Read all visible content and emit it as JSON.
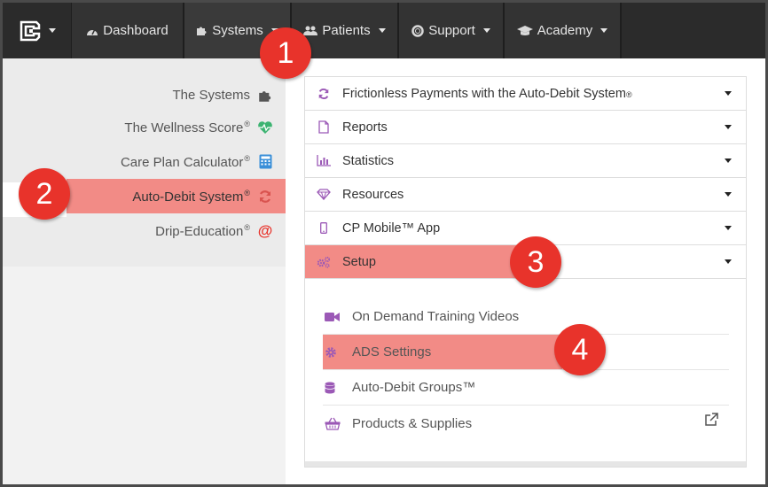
{
  "navbar": {
    "items": [
      {
        "label": "Dashboard",
        "icon": "dashboard-icon"
      },
      {
        "label": "Systems",
        "icon": "puzzle-icon"
      },
      {
        "label": "Patients",
        "icon": "users-icon"
      },
      {
        "label": "Support",
        "icon": "lifebuoy-icon"
      },
      {
        "label": "Academy",
        "icon": "graduation-cap-icon"
      }
    ]
  },
  "sidebar": {
    "items": [
      {
        "label": "The Systems",
        "reg": "",
        "icon": "puzzle-icon"
      },
      {
        "label": "The Wellness Score",
        "reg": "®",
        "icon": "heartbeat-icon"
      },
      {
        "label": "Care Plan Calculator",
        "reg": "®",
        "icon": "calculator-icon"
      },
      {
        "label": "Auto-Debit System",
        "reg": "®",
        "icon": "refresh-icon"
      },
      {
        "label": "Drip-Education",
        "reg": "®",
        "icon": "at-icon"
      }
    ]
  },
  "accordion": {
    "rows": [
      {
        "label": "Frictionless Payments with the Auto-Debit System",
        "reg": "®",
        "icon": "refresh-icon"
      },
      {
        "label": "Reports",
        "reg": "",
        "icon": "file-icon"
      },
      {
        "label": "Statistics",
        "reg": "",
        "icon": "bar-chart-icon"
      },
      {
        "label": "Resources",
        "reg": "",
        "icon": "diamond-icon"
      },
      {
        "label": "CP Mobile™ App",
        "reg": "",
        "icon": "mobile-icon"
      },
      {
        "label": "Setup",
        "reg": "",
        "icon": "cogs-icon"
      }
    ],
    "setup_items": [
      {
        "label": "On Demand Training Videos",
        "icon": "video-camera-icon"
      },
      {
        "label": "ADS Settings",
        "icon": "gear-icon"
      },
      {
        "label": "Auto-Debit Groups™",
        "icon": "database-icon"
      },
      {
        "label": "Products & Supplies",
        "icon": "shopping-basket-icon"
      }
    ]
  },
  "callouts": [
    "1",
    "2",
    "3",
    "4"
  ],
  "colors": {
    "navbar_bg": "#2b2b2b",
    "highlight": "#f28b86",
    "callout": "#e8332b",
    "icon_purple": "#9b59b6"
  }
}
